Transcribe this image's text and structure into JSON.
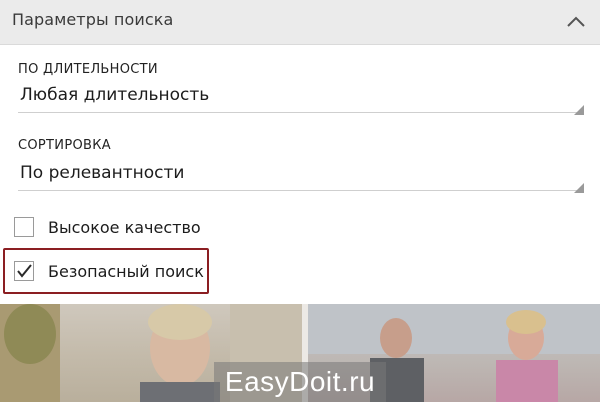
{
  "header": {
    "title": "Параметры поиска",
    "collapse_icon": "chevron-up-icon"
  },
  "duration": {
    "label": "ПО ДЛИТЕЛЬНОСТИ",
    "value": "Любая длительность"
  },
  "sort": {
    "label": "СОРТИРОВКА",
    "value": "По релевантности"
  },
  "options": {
    "high_quality": {
      "label": "Высокое качество",
      "checked": false
    },
    "safe_search": {
      "label": "Безопасный поиск",
      "checked": true
    }
  },
  "highlight_color": "#8b1e22",
  "watermark": "EasyDoit.ru"
}
